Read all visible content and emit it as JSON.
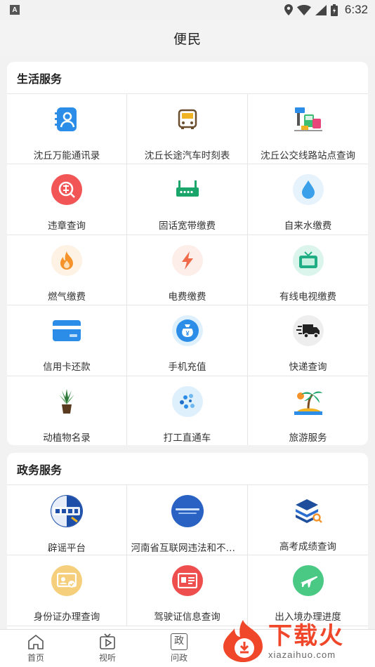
{
  "status_bar": {
    "time": "6:32",
    "badge": "A"
  },
  "header": {
    "title": "便民"
  },
  "life_services": {
    "title": "生活服务",
    "items": [
      {
        "label": "沈丘万能通讯录"
      },
      {
        "label": "沈丘长途汽车时刻表"
      },
      {
        "label": "沈丘公交线路站点查询"
      },
      {
        "label": "违章查询"
      },
      {
        "label": "固话宽带缴费"
      },
      {
        "label": "自来水缴费"
      },
      {
        "label": "燃气缴费"
      },
      {
        "label": "电费缴费"
      },
      {
        "label": "有线电视缴费"
      },
      {
        "label": "信用卡还款"
      },
      {
        "label": "手机充值"
      },
      {
        "label": "快递查询"
      },
      {
        "label": "动植物名录"
      },
      {
        "label": "打工直通车"
      },
      {
        "label": "旅游服务"
      }
    ]
  },
  "gov_services": {
    "title": "政务服务",
    "items": [
      {
        "label": "辟谣平台"
      },
      {
        "label": "河南省互联网违法和不良…"
      },
      {
        "label": "高考成绩查询"
      },
      {
        "label": "身份证办理查询"
      },
      {
        "label": "驾驶证信息查询"
      },
      {
        "label": "出入境办理进度"
      }
    ]
  },
  "tabbar": {
    "items": [
      {
        "label": "首页"
      },
      {
        "label": "视听"
      },
      {
        "label": "问政"
      }
    ],
    "wen_zheng_glyph": "政"
  },
  "watermark": {
    "main": "下载火",
    "sub": "xiazaihuo.com"
  },
  "colors": {
    "accent_red": "#f0462a",
    "blue": "#2b8de8",
    "green": "#1aa56a"
  }
}
